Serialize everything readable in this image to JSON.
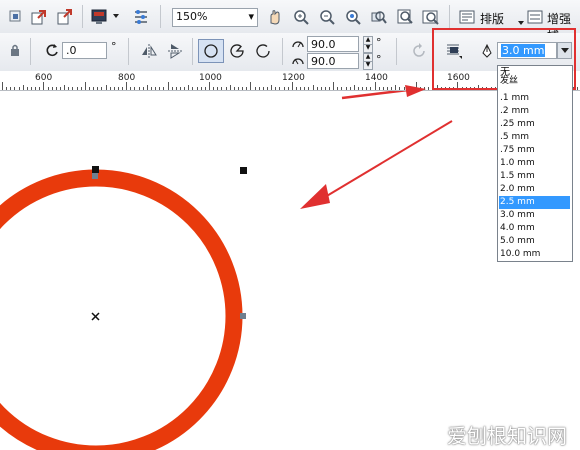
{
  "toolbar_top": {
    "zoom_value": "150%",
    "layout_label": "排版",
    "enhance_label": "增强捕"
  },
  "property_bar": {
    "rotation_value": ".0",
    "degree_symbol": "°",
    "start_angle": "90.0",
    "end_angle": "90.0",
    "outline_width_value": "3.0 mm"
  },
  "ruler": {
    "labels": [
      "600",
      "800",
      "1000",
      "1200",
      "1400",
      "1600"
    ]
  },
  "outline_dropdown": {
    "options": [
      "无",
      "发丝",
      ".1 mm",
      ".2 mm",
      ".25 mm",
      ".5 mm",
      ".75 mm",
      "1.0 mm",
      "1.5 mm",
      "2.0 mm",
      "2.5 mm",
      "3.0 mm",
      "4.0 mm",
      "5.0 mm",
      "10.0 mm"
    ],
    "highlighted": "2.5 mm"
  },
  "watermark": "爱刨根知识网",
  "colors": {
    "circle_outline": "#e83a0c",
    "annotation_red": "#e03030",
    "selection_blue": "#3399ff"
  }
}
